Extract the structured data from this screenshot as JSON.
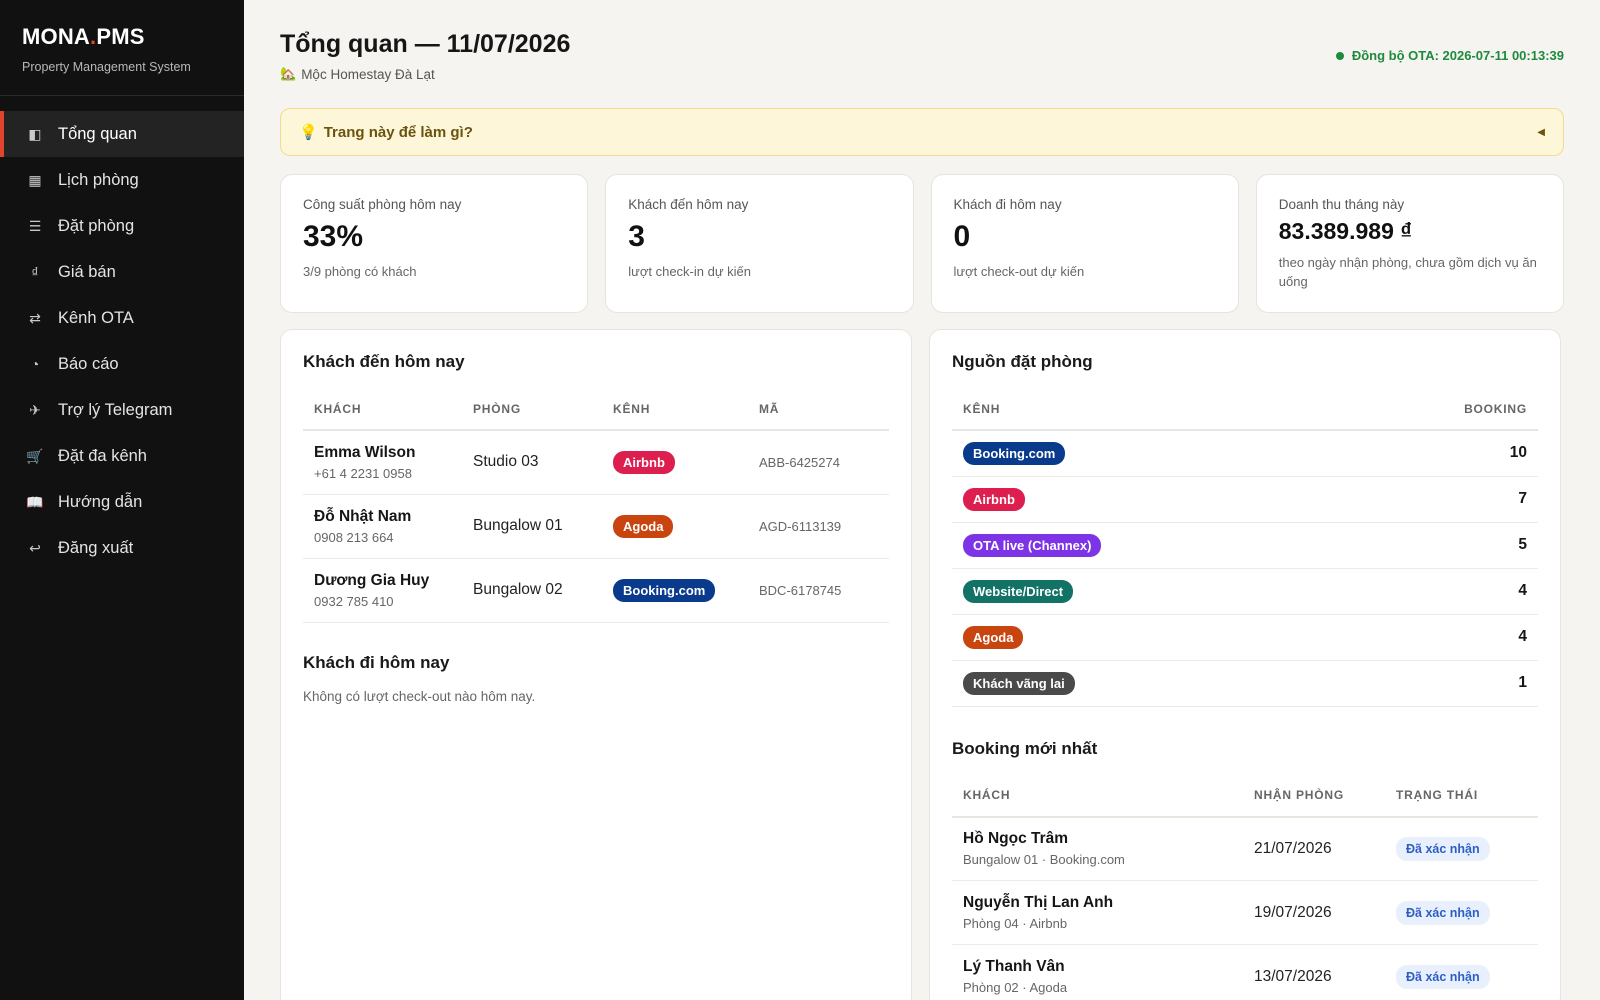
{
  "brand": {
    "name_part1": "MONA",
    "name_dot": ".",
    "name_part2": "PMS",
    "subtitle": "Property Management System"
  },
  "nav": [
    {
      "label": "Tổng quan",
      "icon": "◧",
      "icon_name": "overview-icon",
      "active": true
    },
    {
      "label": "Lịch phòng",
      "icon": "▦",
      "icon_name": "calendar-icon"
    },
    {
      "label": "Đặt phòng",
      "icon": "☰",
      "icon_name": "list-icon"
    },
    {
      "label": "Giá bán",
      "icon": "₫",
      "icon_name": "dong-icon"
    },
    {
      "label": "Kênh OTA",
      "icon": "⇄",
      "icon_name": "sync-arrows-icon"
    },
    {
      "label": "Báo cáo",
      "icon": "◔",
      "icon_name": "report-pie-icon"
    },
    {
      "label": "Trợ lý Telegram",
      "icon": "✈",
      "icon_name": "telegram-plane-icon"
    },
    {
      "label": "Đặt đa kênh",
      "icon": "🛒",
      "icon_name": "cart-icon"
    },
    {
      "label": "Hướng dẫn",
      "icon": "📖",
      "icon_name": "book-icon"
    },
    {
      "label": "Đăng xuất",
      "icon": "↩",
      "icon_name": "logout-icon"
    }
  ],
  "header": {
    "title": "Tổng quan — 11/07/2026",
    "property_icon": "🏡",
    "property": "Mộc Homestay Đà Lạt",
    "sync": "Đồng bộ OTA: 2026-07-11 00:13:39"
  },
  "help": {
    "icon": "💡",
    "label": "Trang này để làm gì?",
    "caret": "◀"
  },
  "stats": [
    {
      "label": "Công suất phòng hôm nay",
      "value": "33%",
      "note": "3/9 phòng có khách"
    },
    {
      "label": "Khách đến hôm nay",
      "value": "3",
      "note": "lượt check-in dự kiến"
    },
    {
      "label": "Khách đi hôm nay",
      "value": "0",
      "note": "lượt check-out dự kiến"
    },
    {
      "label": "Doanh thu tháng này",
      "value": "83.389.989 ₫",
      "note": "theo ngày nhận phòng, chưa gồm dịch vụ ăn uống"
    }
  ],
  "arrivals": {
    "title": "Khách đến hôm nay",
    "columns": [
      "KHÁCH",
      "PHÒNG",
      "KÊNH",
      "MÃ"
    ],
    "rows": [
      {
        "name": "Emma Wilson",
        "phone": "+61 4 2231 0958",
        "room": "Studio 03",
        "channel": "Airbnb",
        "channel_color": "#dc1f4f",
        "code": "ABB-6425274"
      },
      {
        "name": "Đỗ Nhật Nam",
        "phone": "0908 213 664",
        "room": "Bungalow 01",
        "channel": "Agoda",
        "channel_color": "#c9450f",
        "code": "AGD-6113139"
      },
      {
        "name": "Dương Gia Huy",
        "phone": "0932 785 410",
        "room": "Bungalow 02",
        "channel": "Booking.com",
        "channel_color": "#0a3a8c",
        "code": "BDC-6178745"
      }
    ]
  },
  "departures": {
    "title": "Khách đi hôm nay",
    "empty": "Không có lượt check-out nào hôm nay."
  },
  "sources": {
    "title": "Nguồn đặt phòng",
    "columns": [
      "KÊNH",
      "BOOKING"
    ],
    "rows": [
      {
        "channel": "Booking.com",
        "color": "#0a3a8c",
        "count": "10"
      },
      {
        "channel": "Airbnb",
        "color": "#dc1f4f",
        "count": "7"
      },
      {
        "channel": "OTA live (Channex)",
        "color": "#7c34e6",
        "count": "5"
      },
      {
        "channel": "Website/Direct",
        "color": "#127266",
        "count": "4"
      },
      {
        "channel": "Agoda",
        "color": "#c9450f",
        "count": "4"
      },
      {
        "channel": "Khách vãng lai",
        "color": "#4a4a4a",
        "count": "1"
      }
    ]
  },
  "latest": {
    "title": "Booking mới nhất",
    "columns": [
      "KHÁCH",
      "NHẬN PHÒNG",
      "TRẠNG THÁI"
    ],
    "rows": [
      {
        "name": "Hồ Ngọc Trâm",
        "detail": "Bungalow 01 · Booking.com",
        "date": "21/07/2026",
        "status": "Đã xác nhận"
      },
      {
        "name": "Nguyễn Thị Lan Anh",
        "detail": "Phòng 04 · Airbnb",
        "date": "19/07/2026",
        "status": "Đã xác nhận"
      },
      {
        "name": "Lý Thanh Vân",
        "detail": "Phòng 02 · Agoda",
        "date": "13/07/2026",
        "status": "Đã xác nhận"
      }
    ]
  }
}
